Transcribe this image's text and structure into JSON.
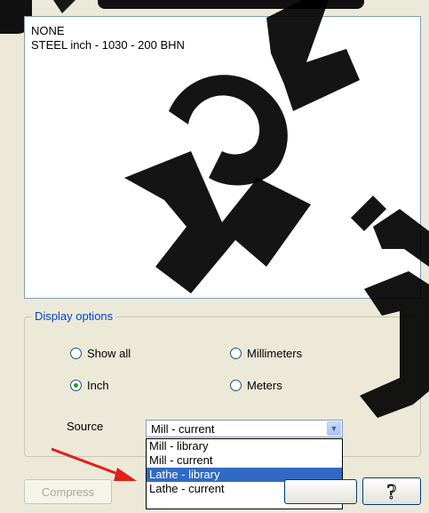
{
  "list": {
    "items": [
      "NONE",
      "STEEL inch - 1030 - 200 BHN"
    ]
  },
  "display_options": {
    "legend": "Display options",
    "radios": {
      "show_all": "Show all",
      "millimeters": "Millimeters",
      "inch": "Inch",
      "meters": "Meters"
    },
    "selected_units": "Inch"
  },
  "source": {
    "label": "Source",
    "value": "Mill - current",
    "options": [
      "Mill - library",
      "Mill - current",
      "Lathe - library",
      "Lathe - current"
    ],
    "highlighted": "Lathe - library"
  },
  "buttons": {
    "compress": "Compress"
  },
  "colors": {
    "accent": "#0046d5",
    "highlight": "#316ac5",
    "arrow": "#e0201a",
    "watermark": "#000000"
  }
}
